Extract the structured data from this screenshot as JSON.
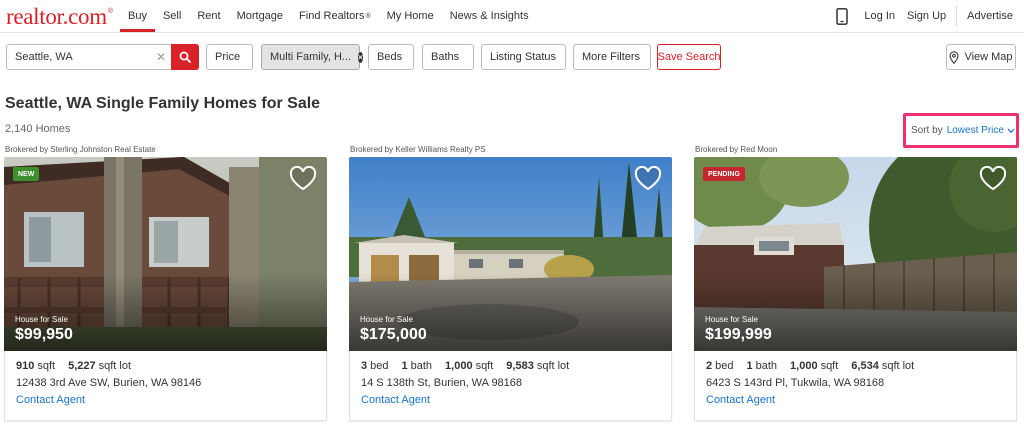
{
  "brand": {
    "name": "realtor.com",
    "mark": "®",
    "color": "#d92228"
  },
  "nav": {
    "items": [
      {
        "label": "Buy",
        "active": true
      },
      {
        "label": "Sell"
      },
      {
        "label": "Rent"
      },
      {
        "label": "Mortgage"
      },
      {
        "label": "Find Realtors",
        "sup": "®"
      },
      {
        "label": "My Home"
      },
      {
        "label": "News & Insights"
      }
    ],
    "login": "Log In",
    "signup": "Sign Up",
    "advertise": "Advertise"
  },
  "search": {
    "value": "Seattle, WA",
    "filters": {
      "price": "Price",
      "property_type": "Multi Family, H...",
      "beds": "Beds",
      "baths": "Baths",
      "listing_status": "Listing Status",
      "more_filters": "More Filters"
    },
    "save_search": "Save Search",
    "view_map": "View Map"
  },
  "results": {
    "title": "Seattle, WA Single Family Homes for Sale",
    "count": "2,140 Homes",
    "sort_label": "Sort by",
    "sort_value": "Lowest Price",
    "highlight_color": "#f0306c"
  },
  "listings": [
    {
      "brokered_by": "Brokered by Sterling Johnston Real Estate",
      "badge": "NEW",
      "type": "House for Sale",
      "price": "$99,950",
      "sqft": "910",
      "sqft_unit": "sqft",
      "lot": "5,227",
      "lot_unit": "sqft lot",
      "address": "12438 3rd Ave SW, Burien, WA 98146",
      "contact": "Contact Agent"
    },
    {
      "brokered_by": "Brokered by Keller Williams Realty PS",
      "type": "House for Sale",
      "price": "$175,000",
      "beds": "3",
      "beds_unit": "bed",
      "baths": "1",
      "baths_unit": "bath",
      "sqft": "1,000",
      "sqft_unit": "sqft",
      "lot": "9,583",
      "lot_unit": "sqft lot",
      "address": "14 S 138th St, Burien, WA 98168",
      "contact": "Contact Agent"
    },
    {
      "brokered_by": "Brokered by Red Moon",
      "badge": "PENDING",
      "type": "House for Sale",
      "price": "$199,999",
      "beds": "2",
      "beds_unit": "bed",
      "baths": "1",
      "baths_unit": "bath",
      "sqft": "1,000",
      "sqft_unit": "sqft",
      "lot": "6,534",
      "lot_unit": "sqft lot",
      "address": "6423 S 143rd Pl, Tukwila, WA 98168",
      "contact": "Contact Agent"
    }
  ],
  "icons": {
    "phone": "mobile-phone-icon",
    "search": "magnifier-icon",
    "clear": "x-icon",
    "chevron": "chevron-down-icon",
    "map_pin": "map-pin-icon",
    "favorite": "heart-outline-icon"
  }
}
